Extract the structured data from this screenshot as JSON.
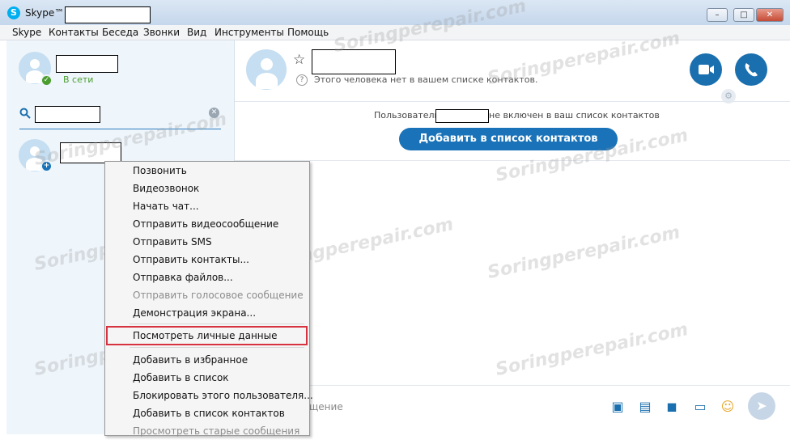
{
  "window": {
    "title": "Skype™ - ",
    "buttons": {
      "minimize": "–",
      "maximize": "□",
      "close": "✕"
    }
  },
  "menu": [
    "Skype",
    "Контакты",
    "Беседа",
    "Звонки",
    "Вид",
    "Инструменты",
    "Помощь"
  ],
  "profile": {
    "status": "В сети"
  },
  "contact_list": {
    "search_icon": "search-icon",
    "clear_icon": "clear-icon"
  },
  "chat_header": {
    "subtitle": "Этого человека нет в вашем списке контактов.",
    "help_glyph": "?"
  },
  "chat_notice": {
    "prefix": "Пользователь",
    "suffix": "не включен в ваш список контактов",
    "add_button": "Добавить в список контактов"
  },
  "context_menu": {
    "items": [
      {
        "label": "Позвонить",
        "enabled": true
      },
      {
        "label": "Видеозвонок",
        "enabled": true
      },
      {
        "label": "Начать чат...",
        "enabled": true
      },
      {
        "label": "Отправить видеосообщение",
        "enabled": true
      },
      {
        "label": "Отправить SMS",
        "enabled": true
      },
      {
        "label": "Отправить контакты...",
        "enabled": true
      },
      {
        "label": "Отправка файлов...",
        "enabled": true
      },
      {
        "label": "Отправить голосовое сообщение",
        "enabled": false
      },
      {
        "label": "Демонстрация экрана...",
        "enabled": true
      },
      {
        "label": "Посмотреть личные данные",
        "enabled": true,
        "highlighted": true
      },
      {
        "label": "Добавить в избранное",
        "enabled": true
      },
      {
        "label": "Добавить в список",
        "enabled": true
      },
      {
        "label": "Блокировать этого пользователя...",
        "enabled": true
      },
      {
        "label": "Добавить в список контактов",
        "enabled": true
      },
      {
        "label": "Просмотреть старые сообщения",
        "enabled": false
      }
    ]
  },
  "compose": {
    "placeholder_fragment": "щение"
  },
  "watermark": "Soringperepair.com",
  "colors": {
    "accent": "#1a6fae",
    "online": "#4a9d2f",
    "highlight_border": "#d7323f"
  }
}
